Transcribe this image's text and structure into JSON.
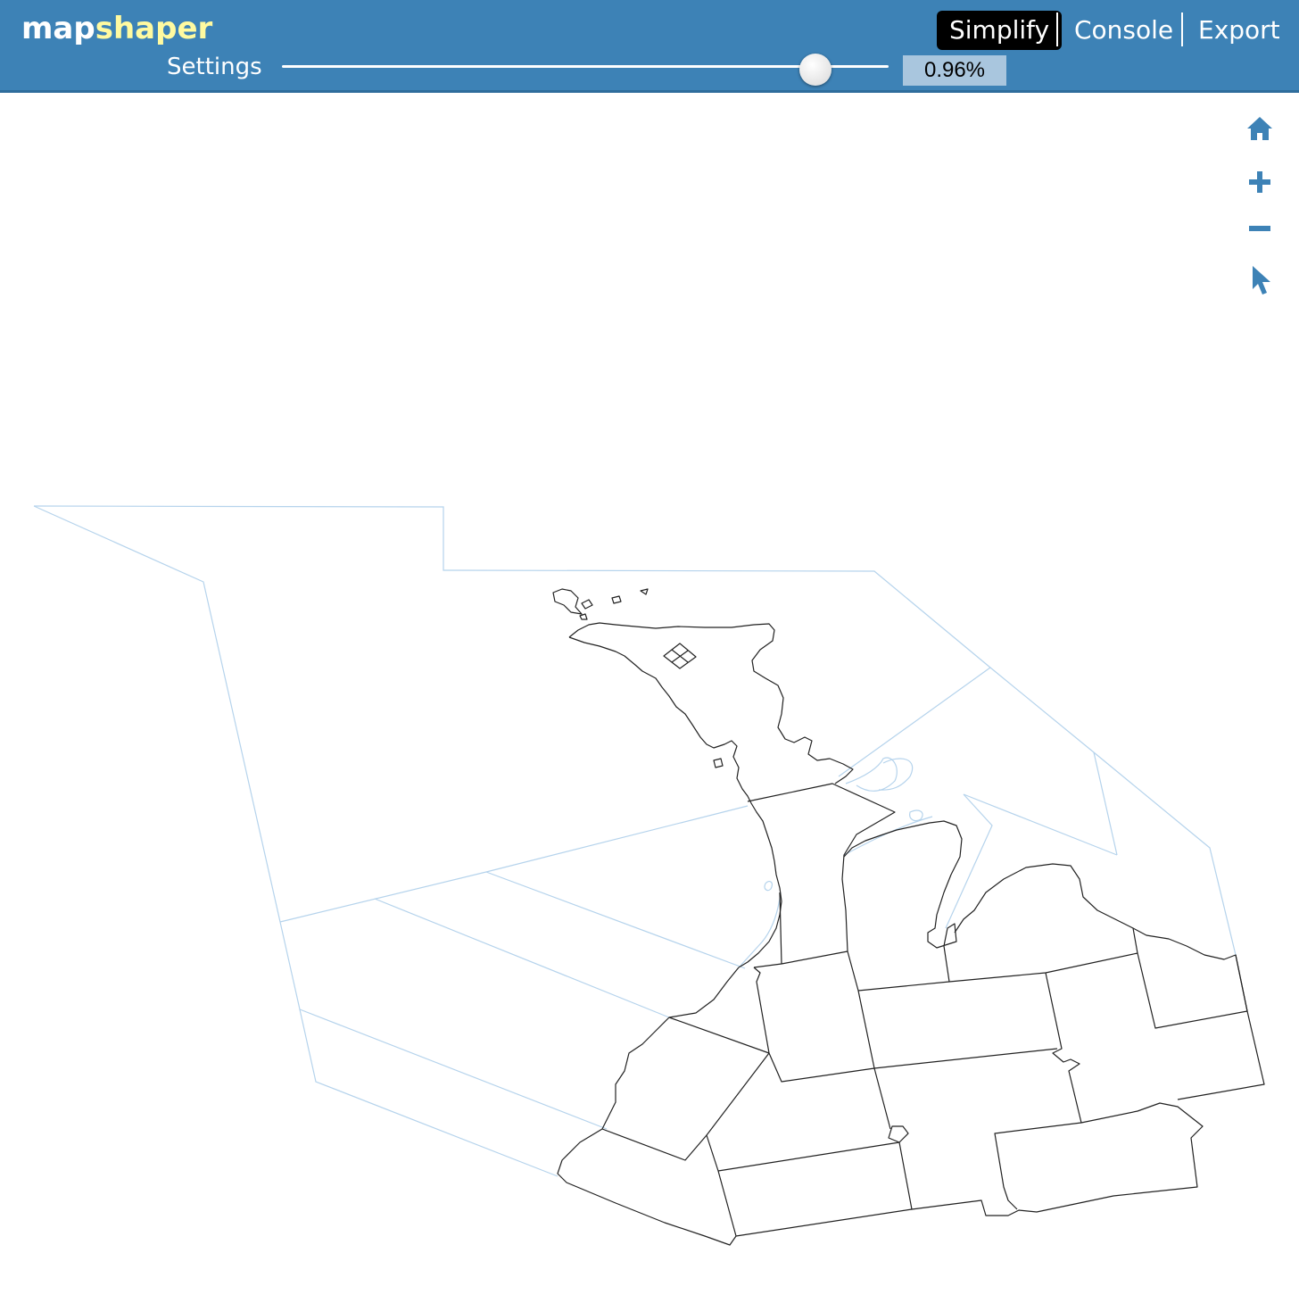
{
  "header": {
    "logo_part1": "map",
    "logo_part2": "shaper",
    "simplify_label": "Simplify",
    "console_label": "Console",
    "export_label": "Export",
    "settings_label": "Settings",
    "simplify_percent": "0.96%",
    "slider_value_fraction": 0.88
  },
  "map_tools": {
    "home": "home-icon",
    "zoom_in": "zoom-in-icon",
    "zoom_out": "zoom-out-icon",
    "select": "pointer-icon"
  },
  "colors": {
    "header_bg": "#3d82b6",
    "logo_accent": "#fffaa0",
    "active_button": "#000000",
    "tool_icon": "#3d82b6",
    "reference_layer": "#b5d3ec",
    "active_layer": "#222222"
  }
}
